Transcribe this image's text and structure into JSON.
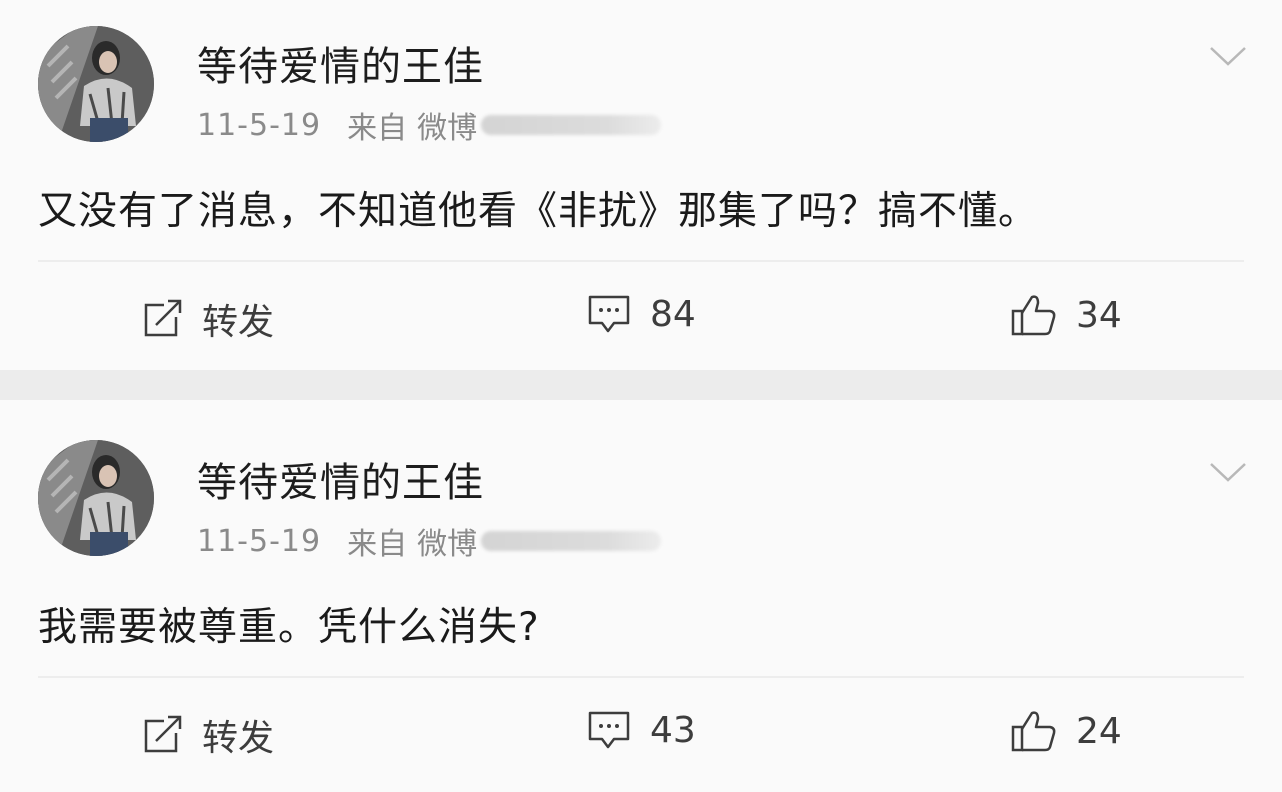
{
  "posts": [
    {
      "username": "等待爱情的王佳",
      "date": "11-5-19",
      "from_label": "来自",
      "source": "微博",
      "text": "又没有了消息，不知道他看《非扰》那集了吗？搞不懂。",
      "repost_label": "转发",
      "comments": "84",
      "likes": "34"
    },
    {
      "username": "等待爱情的王佳",
      "date": "11-5-19",
      "from_label": "来自",
      "source": "微博",
      "text": "我需要被尊重。凭什么消失?",
      "repost_label": "转发",
      "comments": "43",
      "likes": "24"
    }
  ],
  "icons": {
    "repost": "edit-share-icon",
    "comment": "comment-bubble-icon",
    "like": "thumbs-up-icon",
    "menu": "chevron-down-icon"
  },
  "colors": {
    "card_background": "#fafafa",
    "separator": "#ececec",
    "username": "#1d1d1d",
    "meta": "#8a8a8a",
    "action": "#3d3d3d"
  }
}
